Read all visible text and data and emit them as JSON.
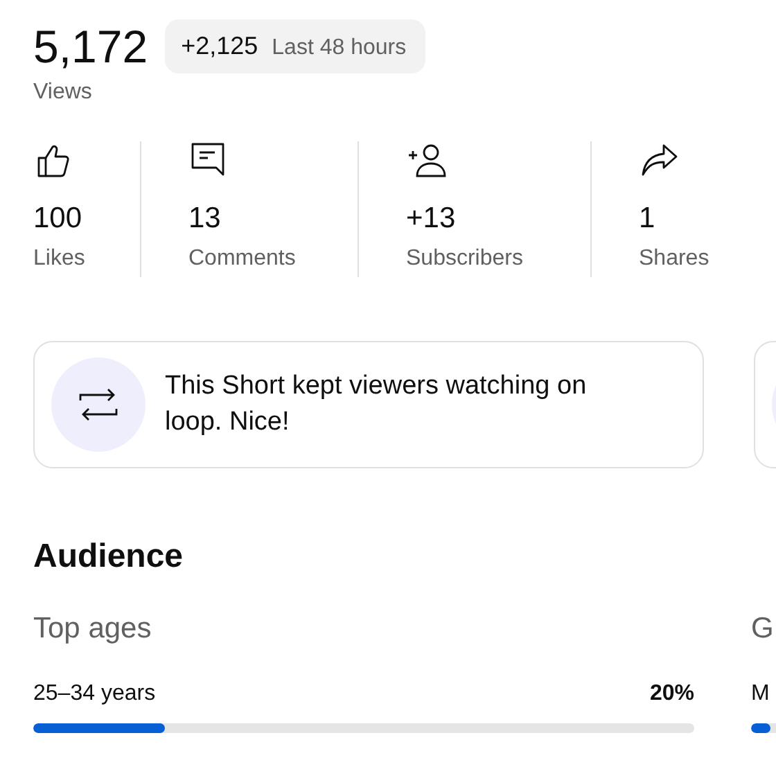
{
  "views": {
    "value": "5,172",
    "label": "Views"
  },
  "change_badge": {
    "delta": "+2,125",
    "period": "Last 48 hours"
  },
  "stats": [
    {
      "kind": "likes",
      "value": "100",
      "label": "Likes"
    },
    {
      "kind": "comments",
      "value": "13",
      "label": "Comments"
    },
    {
      "kind": "subscribers",
      "value": "+13",
      "label": "Subscribers"
    },
    {
      "kind": "shares",
      "value": "1",
      "label": "Shares"
    }
  ],
  "insight_cards": [
    {
      "kind": "loop",
      "text": "This Short kept viewers watching on loop. Nice!"
    },
    {
      "kind": "blank"
    }
  ],
  "audience": {
    "title": "Audience",
    "panels": [
      {
        "title": "Top ages",
        "rows": [
          {
            "label": "25–34 years",
            "value": "20%",
            "level": 0.2
          }
        ]
      },
      {
        "title": "G",
        "rows": [
          {
            "label": "M",
            "level": 0.03
          }
        ]
      }
    ]
  }
}
